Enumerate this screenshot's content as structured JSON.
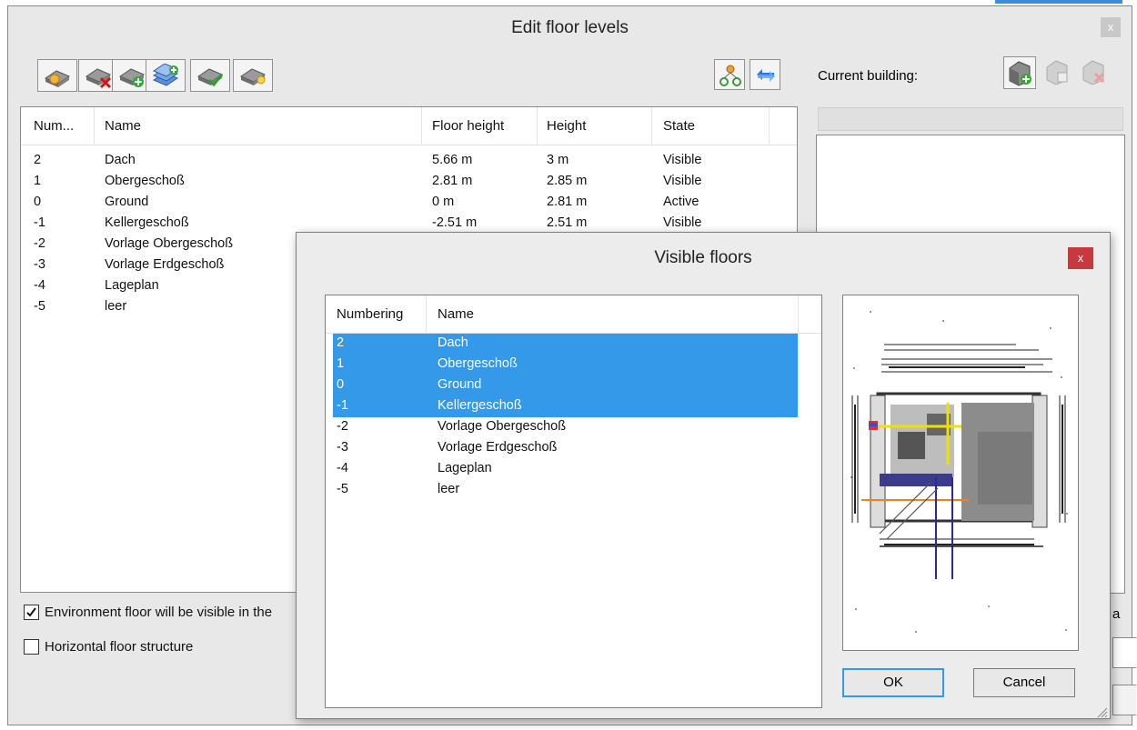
{
  "main_window": {
    "title": "Edit floor levels",
    "close_glyph": "x"
  },
  "floor_table": {
    "headers": [
      "Num...",
      "Name",
      "Floor height",
      "Height",
      "State"
    ],
    "rows": [
      {
        "num": "2",
        "name": "Dach",
        "floor_height": "5.66 m",
        "height": "3 m",
        "state": "Visible"
      },
      {
        "num": "1",
        "name": "Obergeschoß",
        "floor_height": "2.81 m",
        "height": "2.85 m",
        "state": "Visible"
      },
      {
        "num": "0",
        "name": "Ground",
        "floor_height": "0 m",
        "height": "2.81 m",
        "state": "Active"
      },
      {
        "num": "-1",
        "name": "Kellergeschoß",
        "floor_height": "-2.51 m",
        "height": "2.51 m",
        "state": "Visible"
      },
      {
        "num": "-2",
        "name": "Vorlage Obergeschoß",
        "floor_height": "",
        "height": "",
        "state": ""
      },
      {
        "num": "-3",
        "name": "Vorlage Erdgeschoß",
        "floor_height": "",
        "height": "",
        "state": ""
      },
      {
        "num": "-4",
        "name": "Lageplan",
        "floor_height": "",
        "height": "",
        "state": ""
      },
      {
        "num": "-5",
        "name": "leer",
        "floor_height": "",
        "height": "",
        "state": ""
      }
    ]
  },
  "options": {
    "environment_floor_label": "Environment floor will be visible in the",
    "environment_floor_checked": true,
    "horizontal_structure_label": "Horizontal floor structure",
    "horizontal_structure_checked": false
  },
  "right_panel": {
    "current_building_label": "Current building:",
    "edge_char": "a"
  },
  "visible_floors_dialog": {
    "title": "Visible floors",
    "close_glyph": "x",
    "headers": [
      "Numbering",
      "Name"
    ],
    "rows": [
      {
        "num": "2",
        "name": "Dach",
        "selected": true
      },
      {
        "num": "1",
        "name": "Obergeschoß",
        "selected": true
      },
      {
        "num": "0",
        "name": "Ground",
        "selected": true
      },
      {
        "num": "-1",
        "name": "Kellergeschoß",
        "selected": true
      },
      {
        "num": "-2",
        "name": "Vorlage Obergeschoß",
        "selected": false
      },
      {
        "num": "-3",
        "name": "Vorlage Erdgeschoß",
        "selected": false
      },
      {
        "num": "-4",
        "name": "Lageplan",
        "selected": false
      },
      {
        "num": "-5",
        "name": "leer",
        "selected": false
      }
    ],
    "ok_label": "OK",
    "cancel_label": "Cancel"
  },
  "colors": {
    "selection": "#3399e8",
    "close_red": "#c7393c",
    "window_bg": "#e8e8e8"
  },
  "toolbar_icons": [
    "insert-floor-icon",
    "delete-floor-icon",
    "add-floor-icon",
    "add-multiple-floors-icon",
    "check-floor-icon",
    "floor-light-icon",
    "floor-tree-icon",
    "swap-arrows-icon"
  ],
  "building_icons": [
    "add-building-icon",
    "building-info-icon",
    "delete-building-icon"
  ]
}
